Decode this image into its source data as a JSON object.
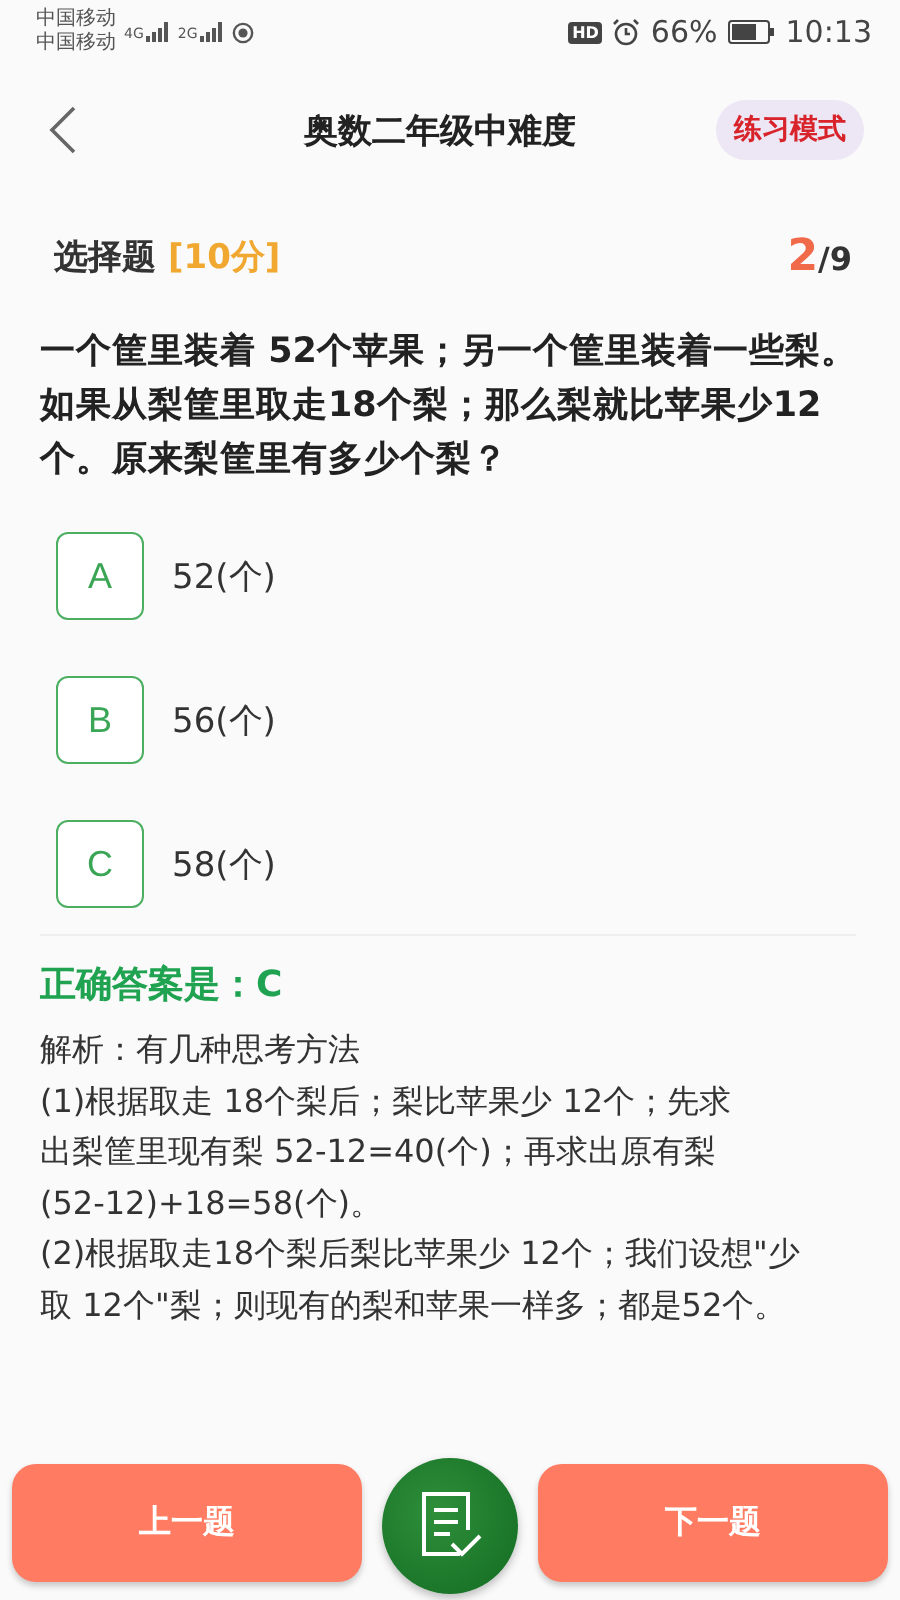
{
  "status_bar": {
    "carriers": [
      "中国移动",
      "中国移动"
    ],
    "networks": [
      "4G",
      "2G"
    ],
    "hd": "HD",
    "battery": "66%",
    "time": "10:13"
  },
  "header": {
    "title": "奥数二年级中难度",
    "mode": "练习模式"
  },
  "question": {
    "type": "选择题",
    "score": "[10分]",
    "current": "2",
    "total": "/9",
    "text": "一个筐里装着 52个苹果；另一个筐里装着一些梨。如果从梨筐里取走18个梨；那么梨就比苹果少12个。原来梨筐里有多少个梨？"
  },
  "options": [
    {
      "letter": "A",
      "text": "52(个)"
    },
    {
      "letter": "B",
      "text": "56(个)"
    },
    {
      "letter": "C",
      "text": "58(个)"
    }
  ],
  "answer": "正确答案是：C",
  "explanation": [
    "解析：有几种思考方法",
    "(1)根据取走 18个梨后；梨比苹果少 12个；先求",
    "出梨筐里现有梨 52-12=40(个)；再求出原有梨",
    "(52-12)+18=58(个)。",
    "(2)根据取走18个梨后梨比苹果少 12个；我们设想\"少",
    "取 12个\"梨；则现有的梨和苹果一样多；都是52个。"
  ],
  "buttons": {
    "prev": "上一题",
    "next": "下一题"
  }
}
